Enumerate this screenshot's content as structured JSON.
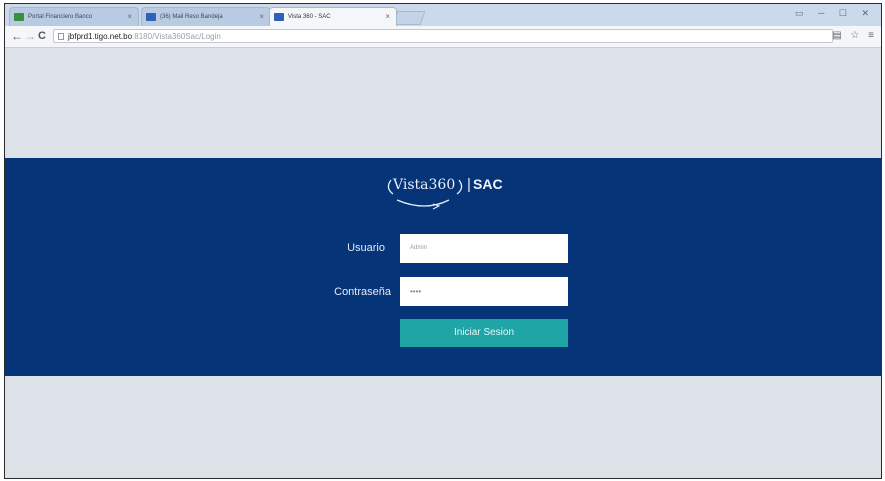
{
  "browser": {
    "tabs": [
      {
        "label": "Portal Financiero Banco",
        "active": false,
        "favicon_color": "#3a8f3a"
      },
      {
        "label": "(36) Mail Reso Bandeja",
        "active": false,
        "favicon_color": "#2b62b8"
      },
      {
        "label": "Vista 360 - SAC",
        "active": true,
        "favicon_color": "#2b62b8"
      }
    ],
    "tab_close": "×",
    "window_controls": "▭ ─ ☐ ✕",
    "back": "←",
    "forward": "→",
    "reload": "C",
    "url_host": "jbfprd1.tigo.net.bo",
    "url_path": ":8180/Vista360Sac/Login",
    "toolbar_right": "▤ ☆ ≡"
  },
  "login": {
    "logo_text": "Vista360",
    "logo_suffix": "SAC",
    "username_label": "Usuario",
    "username_value": "Admin",
    "password_label": "Contraseña",
    "password_value": "••••",
    "submit_label": "Iniciar Sesion"
  },
  "colors": {
    "band": "#053478",
    "button": "#20a5a7",
    "page_bg": "#dde1e8"
  }
}
